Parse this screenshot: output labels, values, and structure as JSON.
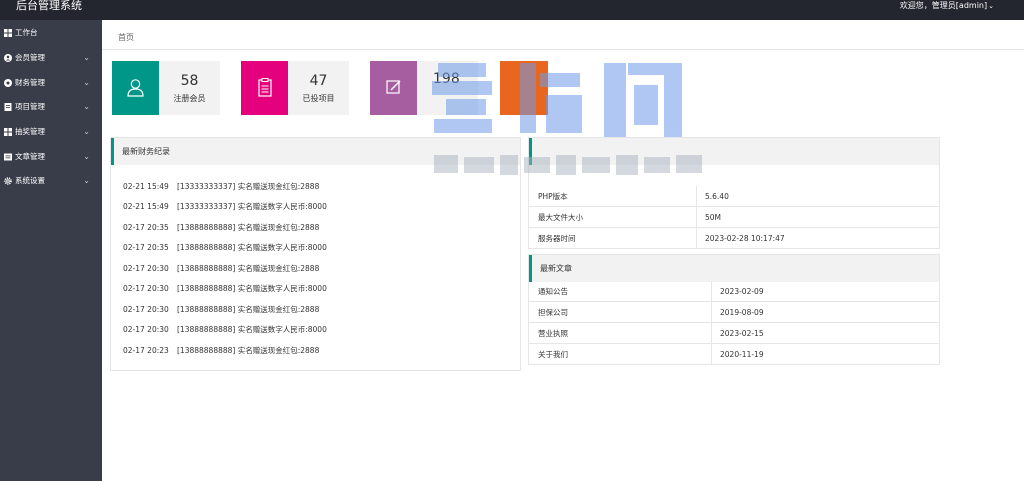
{
  "app": {
    "title": "后台管理系统"
  },
  "header": {
    "user_greeting": "欢迎您，管理员[admin]"
  },
  "sidebar": {
    "items": [
      {
        "label": "工作台",
        "icon": "dashboard-icon",
        "expandable": false
      },
      {
        "label": "会员管理",
        "icon": "user-icon",
        "expandable": true
      },
      {
        "label": "财务管理",
        "icon": "finance-icon",
        "expandable": true
      },
      {
        "label": "项目管理",
        "icon": "project-icon",
        "expandable": true
      },
      {
        "label": "抽奖管理",
        "icon": "lottery-icon",
        "expandable": true
      },
      {
        "label": "文章管理",
        "icon": "article-icon",
        "expandable": true
      },
      {
        "label": "系统设置",
        "icon": "gear-icon",
        "expandable": true
      }
    ]
  },
  "breadcrumb": {
    "home": "首页"
  },
  "stats": [
    {
      "value": "58",
      "label": "注册会员",
      "color": "#009688",
      "icon": "user-outline-icon"
    },
    {
      "value": "47",
      "label": "已投项目",
      "color": "#e5007e",
      "icon": "clipboard-icon"
    },
    {
      "value": "198",
      "label": "",
      "color": "#a65ea0",
      "icon": "edit-icon"
    },
    {
      "value": "",
      "label": "",
      "color": "#e8661e",
      "icon": ""
    }
  ],
  "finance": {
    "title": "最新财务纪录",
    "rows": [
      {
        "time": "02-21 15:49",
        "text": "[13333333337] 实名赠送现金红包:2888"
      },
      {
        "time": "02-21 15:49",
        "text": "[13333333337] 实名赠送数字人民币:8000"
      },
      {
        "time": "02-17 20:35",
        "text": "[13888888888] 实名赠送现金红包:2888"
      },
      {
        "time": "02-17 20:35",
        "text": "[13888888888] 实名赠送数字人民币:8000"
      },
      {
        "time": "02-17 20:30",
        "text": "[13888888888] 实名赠送现金红包:2888"
      },
      {
        "time": "02-17 20:30",
        "text": "[13888888888] 实名赠送数字人民币:8000"
      },
      {
        "time": "02-17 20:30",
        "text": "[13888888888] 实名赠送现金红包:2888"
      },
      {
        "time": "02-17 20:30",
        "text": "[13888888888] 实名赠送数字人民币:8000"
      },
      {
        "time": "02-17 20:23",
        "text": "[13888888888] 实名赠送现金红包:2888"
      }
    ]
  },
  "sysinfo": {
    "rows": [
      {
        "key": "PHP版本",
        "value": "5.6.40"
      },
      {
        "key": "最大文件大小",
        "value": "50M"
      },
      {
        "key": "服务器时间",
        "value": "2023-02-28 10:17:47"
      }
    ]
  },
  "articles": {
    "title": "最新文章",
    "rows": [
      {
        "name": "通知公告",
        "date": "2023-02-09"
      },
      {
        "name": "担保公司",
        "date": "2019-08-09"
      },
      {
        "name": "营业执照",
        "date": "2023-02-15"
      },
      {
        "name": "关于我们",
        "date": "2020-11-19"
      }
    ]
  },
  "colors": {
    "topbar": "#23262e",
    "sidebar": "#393d49",
    "accent": "#009688"
  }
}
